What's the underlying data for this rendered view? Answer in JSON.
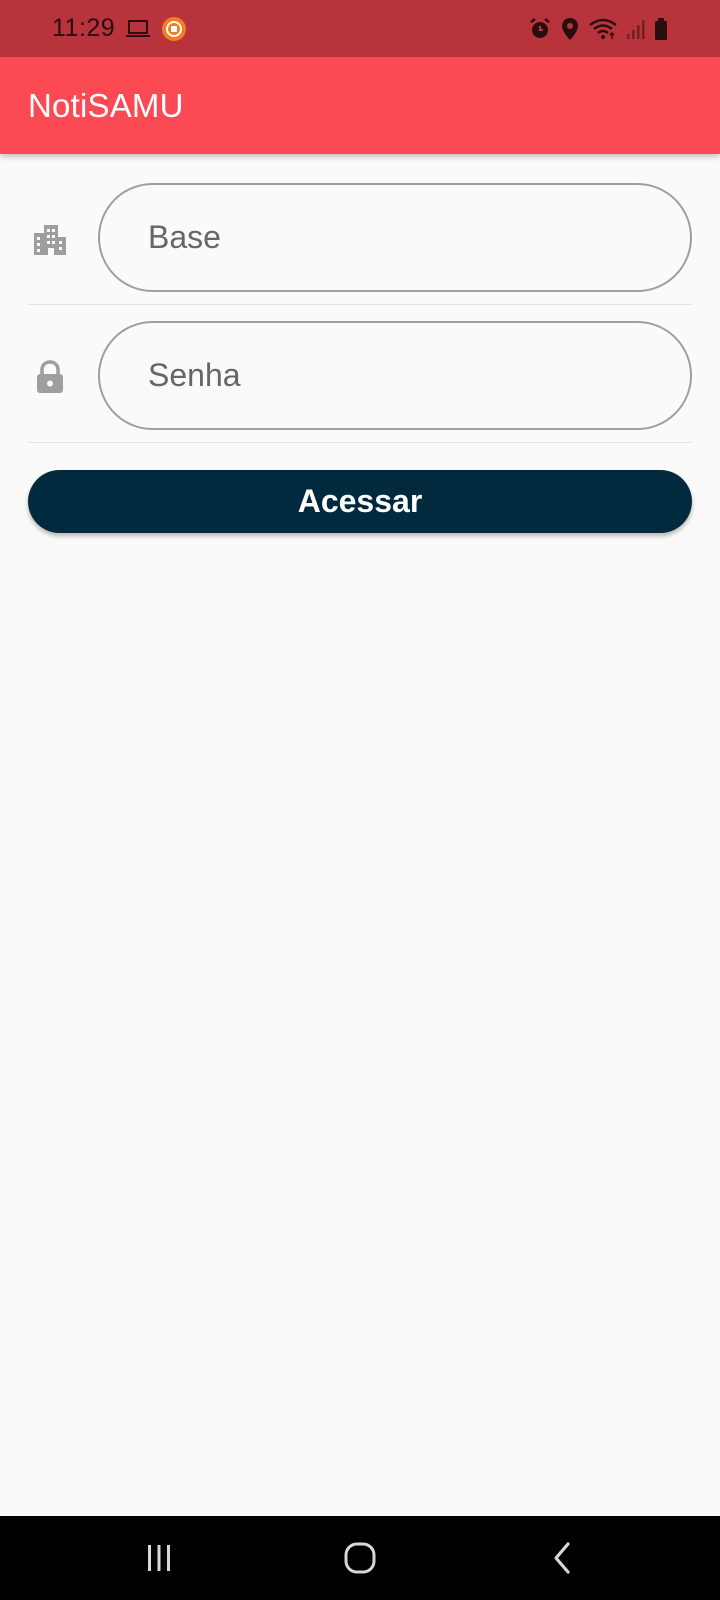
{
  "status_bar": {
    "time": "11:29",
    "left_icons": [
      "laptop-icon",
      "screen-record-icon"
    ],
    "right_icons": [
      "alarm-icon",
      "location-icon",
      "wifi-icon",
      "signal-icon",
      "battery-icon"
    ]
  },
  "app_bar": {
    "title": "NotiSAMU",
    "color": "#fc4a55"
  },
  "form": {
    "base": {
      "icon": "building-icon",
      "value": "",
      "placeholder": "Base"
    },
    "senha": {
      "icon": "lock-icon",
      "value": "",
      "placeholder": "Senha"
    },
    "submit_label": "Acessar",
    "submit_color": "#022a3e"
  },
  "nav_bar": {
    "buttons": [
      "recents-icon",
      "home-icon",
      "back-icon"
    ]
  }
}
